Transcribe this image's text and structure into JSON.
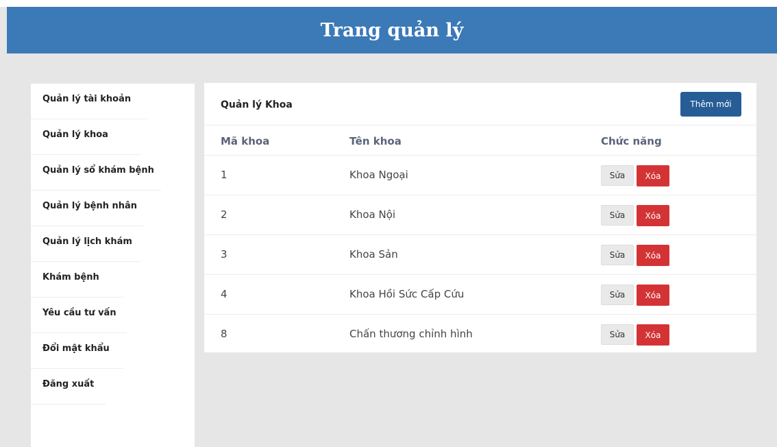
{
  "header": {
    "title": "Trang quản lý"
  },
  "sidebar": {
    "items": [
      {
        "label": "Quản lý tài khoản"
      },
      {
        "label": "Quản lý khoa"
      },
      {
        "label": "Quản lý sổ khám bệnh"
      },
      {
        "label": "Quản lý bệnh nhân"
      },
      {
        "label": "Quản lý lịch khám"
      },
      {
        "label": "Khám bệnh"
      },
      {
        "label": "Yêu cầu tư vấn"
      },
      {
        "label": "Đổi mật khẩu"
      },
      {
        "label": "Đăng xuất"
      }
    ]
  },
  "panel": {
    "title": "Quản lý Khoa",
    "add_label": "Thêm mới",
    "columns": [
      "Mã khoa",
      "Tên khoa",
      "Chức năng"
    ],
    "edit_label": "Sửa",
    "delete_label": "Xóa",
    "rows": [
      {
        "id": "1",
        "name": "Khoa Ngoại"
      },
      {
        "id": "2",
        "name": "Khoa Nội"
      },
      {
        "id": "3",
        "name": "Khoa Sản"
      },
      {
        "id": "4",
        "name": "Khoa Hồi Sức Cấp Cứu"
      },
      {
        "id": "8",
        "name": "Chấn thương chỉnh hình"
      }
    ]
  },
  "colors": {
    "header_bg": "#3b79b7",
    "add_button": "#275d96",
    "delete_button": "#d43335",
    "page_bg": "#e6e6e6"
  }
}
